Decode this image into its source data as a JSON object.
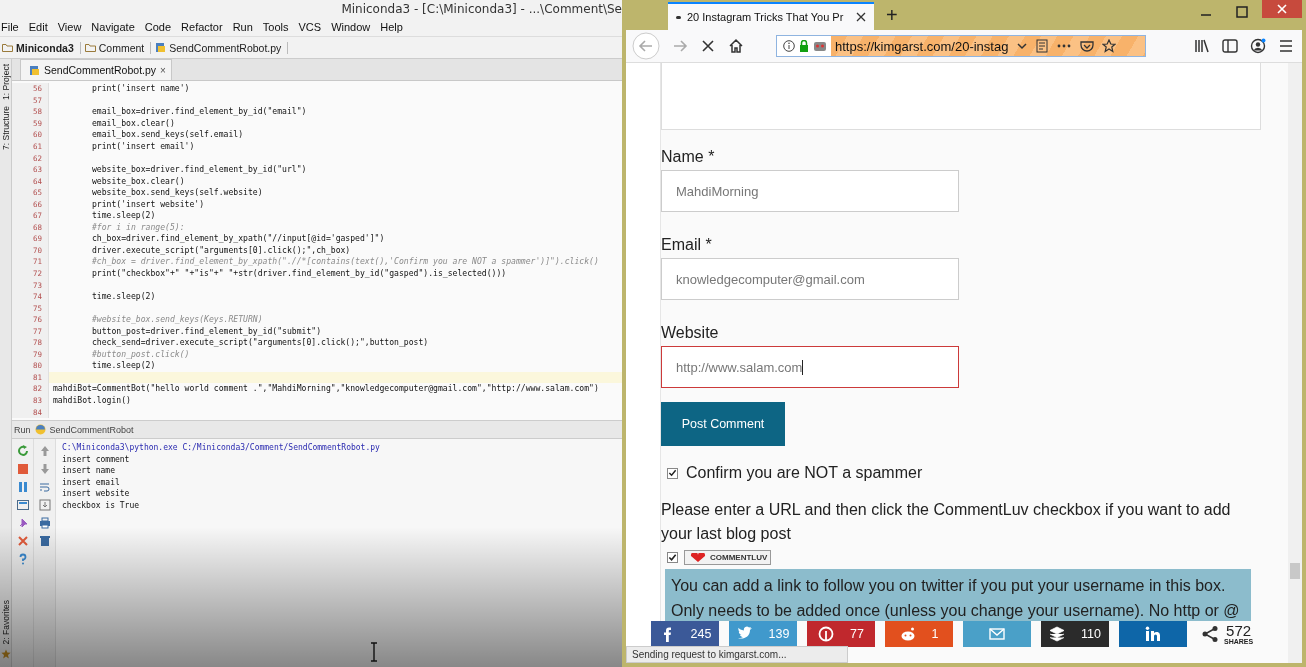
{
  "ide": {
    "title": "Miniconda3 - [C:\\Miniconda3] - ...\\Comment\\Se",
    "menu": [
      "File",
      "Edit",
      "View",
      "Navigate",
      "Code",
      "Refactor",
      "Run",
      "Tools",
      "VCS",
      "Window",
      "Help"
    ],
    "breadcrumbs": [
      {
        "label": "Miniconda3",
        "kind": "folder"
      },
      {
        "label": "Comment",
        "kind": "folder"
      },
      {
        "label": "SendCommentRobot.py",
        "kind": "file"
      }
    ],
    "side_tabs": [
      "1: Project",
      "7: Structure"
    ],
    "bottom_side_tab": "2: Favorites",
    "editor_tab": {
      "label": "SendCommentRobot.py",
      "close": "×"
    },
    "code_lines": [
      {
        "number": "56",
        "text": "        print('insert name')",
        "kind": "code",
        "current": false
      },
      {
        "number": "57",
        "kind": "code",
        "current": false
      },
      {
        "number": "58",
        "text": "        email_box=driver.find_element_by_id(\"email\")",
        "kind": "code",
        "current": false
      },
      {
        "number": "59",
        "text": "        email_box.clear()",
        "kind": "code",
        "current": false
      },
      {
        "number": "60",
        "text": "        email_box.send_keys(self.email)",
        "kind": "code",
        "current": false
      },
      {
        "number": "61",
        "text": "        print('insert email')",
        "kind": "code",
        "current": false
      },
      {
        "number": "62",
        "kind": "code",
        "current": false
      },
      {
        "number": "63",
        "text": "        website_box=driver.find_element_by_id(\"url\")",
        "kind": "code",
        "current": false
      },
      {
        "number": "64",
        "text": "        website_box.clear()",
        "kind": "code",
        "current": false
      },
      {
        "number": "65",
        "text": "        website_box.send_keys(self.website)",
        "kind": "code",
        "current": false
      },
      {
        "number": "66",
        "text": "        print('insert website')",
        "kind": "code",
        "current": false
      },
      {
        "number": "67",
        "text": "        time.sleep(2)",
        "kind": "code",
        "current": false
      },
      {
        "number": "68",
        "text": "        #for i in range(5):",
        "kind": "comment",
        "current": false
      },
      {
        "number": "69",
        "text": "        ch_box=driver.find_element_by_xpath(\"//input[@id='gasped']\")",
        "kind": "code",
        "current": false
      },
      {
        "number": "70",
        "text": "        driver.execute_script(\"arguments[0].click();\",ch_box)",
        "kind": "code",
        "current": false
      },
      {
        "number": "71",
        "text": "        #ch_box = driver.find_element_by_xpath(\".//*[contains(text(),'Confirm you are NOT a spammer')]\").click()",
        "kind": "comment",
        "current": false
      },
      {
        "number": "72",
        "text": "        print(\"checkbox\"+\" \"+\"is\"+\" \"+str(driver.find_element_by_id(\"gasped\").is_selected()))",
        "kind": "code",
        "current": false
      },
      {
        "number": "73",
        "kind": "code",
        "current": false
      },
      {
        "number": "74",
        "text": "        time.sleep(2)",
        "kind": "code",
        "current": false
      },
      {
        "number": "75",
        "kind": "code",
        "current": false
      },
      {
        "number": "76",
        "text": "        #website_box.send_keys(Keys.RETURN)",
        "kind": "comment",
        "current": false
      },
      {
        "number": "77",
        "text": "        button_post=driver.find_element_by_id(\"submit\")",
        "kind": "code",
        "current": false
      },
      {
        "number": "78",
        "text": "        check_send=driver.execute_script(\"arguments[0].click();\",button_post)",
        "kind": "code",
        "current": false
      },
      {
        "number": "79",
        "text": "        #button_post.click()",
        "kind": "comment",
        "current": false
      },
      {
        "number": "80",
        "text": "        time.sleep(2)",
        "kind": "code",
        "current": false
      },
      {
        "number": "81",
        "kind": "code",
        "current": true
      },
      {
        "number": "82",
        "text": "mahdiBot=CommentBot(\"hello world comment .\",\"MahdiMorning\",\"knowledgecomputer@gmail.com\",\"http://www.salam.com\")",
        "kind": "code",
        "current": false
      },
      {
        "number": "83",
        "text": "mahdiBot.login()",
        "kind": "code",
        "current": false
      },
      {
        "number": "84",
        "kind": "code",
        "current": false
      }
    ],
    "run_panel": {
      "label": "Run",
      "config": "SendCommentRobot",
      "output": [
        {
          "text": "C:\\Miniconda3\\python.exe C:/Miniconda3/Comment/SendCommentRobot.py",
          "kind": "command"
        },
        {
          "text": "insert comment",
          "kind": "output"
        },
        {
          "text": "insert name",
          "kind": "output"
        },
        {
          "text": "insert email",
          "kind": "output"
        },
        {
          "text": "insert website",
          "kind": "output"
        },
        {
          "text": "checkbox is True",
          "kind": "output"
        }
      ]
    }
  },
  "browser": {
    "tab": {
      "title": "20 Instagram Tricks That You Pr"
    },
    "new_tab": "+",
    "url": "https://kimgarst.com/20-instag",
    "form": {
      "fields": [
        {
          "label": "Name *",
          "value": "MahdiMorning",
          "focused": false
        },
        {
          "label": "Email *",
          "value": "knowledgecomputer@gmail.com",
          "focused": false
        },
        {
          "label": "Website",
          "value": "http://www.salam.com",
          "focused": true
        }
      ],
      "submit": "Post Comment",
      "spam_check": {
        "label": "Confirm you are NOT a spammer",
        "checked": true
      },
      "note": "Please enter a URL and then click the CommentLuv checkbox if you want to add your last blog post",
      "commentluv": {
        "checked": true,
        "badge": "COMMENTLUV"
      },
      "twitter_note": "You can add a link to follow you on twitter if you put your username in this box. Only needs to be added once (unless you change your username). No http or @"
    },
    "share_bar": [
      {
        "kind": "facebook",
        "count": "245",
        "color": "#3b5998"
      },
      {
        "kind": "twitter",
        "count": "139",
        "color": "#4099cc"
      },
      {
        "kind": "pinterest",
        "count": "77",
        "color": "#c0282d"
      },
      {
        "kind": "reddit",
        "count": "1",
        "color": "#e2501e"
      },
      {
        "kind": "email",
        "color": "#4aa0c8"
      },
      {
        "kind": "buffer",
        "count": "110",
        "color": "#2b2b2b"
      },
      {
        "kind": "linkedin",
        "color": "#0e66a8"
      }
    ],
    "share_total": {
      "count": "572",
      "label": "SHARES"
    },
    "status": "Sending request to kimgarst.com..."
  }
}
